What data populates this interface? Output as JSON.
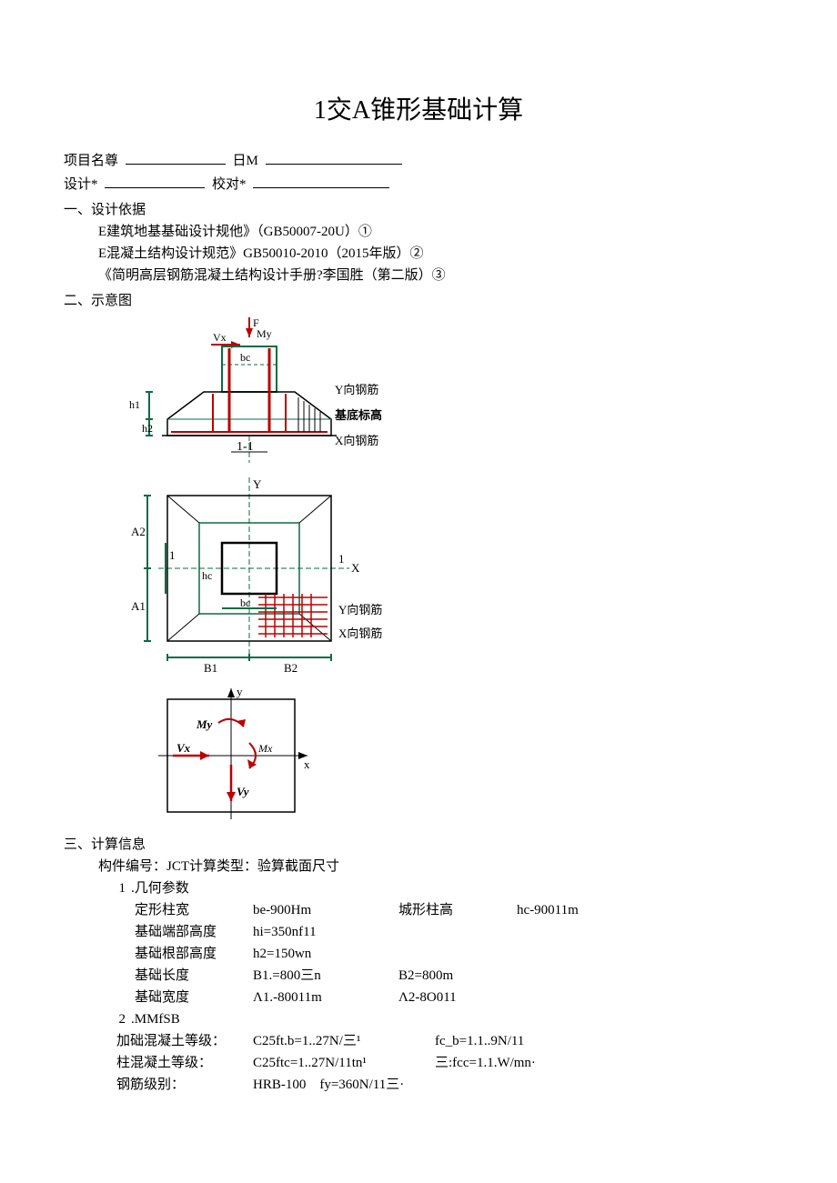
{
  "title": "1交A锥形基础计算",
  "header": {
    "proj_label": "项目名尊",
    "date_label": "日M",
    "design_label": "设计*",
    "check_label": "校对*"
  },
  "sec1": {
    "head": "一、设计依据",
    "line1": "E建筑地基基础设计规他》（GB50007-20U）①",
    "line2": "E混凝土结构设计规范》GB50010-2010（2015年版）②",
    "line3": "《简明高层钢筋混凝土结构设计手册?李国胜（第二版）③"
  },
  "sec2": {
    "head": "二、示意图",
    "d1": {
      "F": "F",
      "My": "My",
      "Vx": "Vx",
      "bc": "bc",
      "h1": "h1",
      "h2": "h2",
      "sect": "1-1",
      "ysteel": "Y向钢筋",
      "base": "基底标高",
      "xsteel": "X向钢筋"
    },
    "d2": {
      "Y": "Y",
      "X": "X",
      "A1": "A1",
      "A2": "A2",
      "B1": "B1",
      "B2": "B2",
      "one": "1",
      "hc": "hc",
      "bc": "bc",
      "ysteel": "Y向钢筋",
      "xsteel": "X向钢筋"
    },
    "d3": {
      "y": "y",
      "x": "x",
      "My": "My",
      "Mx": "Mx",
      "Vx": "Vx",
      "Vy": "Vy"
    }
  },
  "sec3": {
    "head": "三、计算信息",
    "comp": "构件编号：JCT计算类型：验算截面尺寸",
    "g1_num": "1",
    "g1_label": ".几何参数",
    "geom": {
      "r1c1": "定形柱宽",
      "r1c2": "be-900Hm",
      "r1c3": "城形柱高",
      "r1c4": "hc-90011m",
      "r2c1": "基础端部高度",
      "r2c2": "hi=350nf11",
      "r3c1": "基础根部高度",
      "r3c2": "h2=150wn",
      "r4c1": "基础长度",
      "r4c2": "B1.=800三n",
      "r4c3": "B2=800m",
      "r5c1": "基础宽度",
      "r5c2": "Λ1.-80011m",
      "r5c3": "Λ2-8O011"
    },
    "g2_num": "2",
    "g2_label": ".MMfSB",
    "mat": {
      "r1m1": "加础混凝土等级：",
      "r1m2": "C25ft.b=1..27N/三¹",
      "r1m3": "fc_b=1.1..9N/11",
      "r2m1": "柱混凝土等级：",
      "r2m2": "C25ftc=1..27N/11tn¹",
      "r2m3": "三:fcc=1.1.W/mn·",
      "r3m1": "钢筋级别：",
      "r3m2": "HRB-100　fy=360N/11三·"
    }
  }
}
